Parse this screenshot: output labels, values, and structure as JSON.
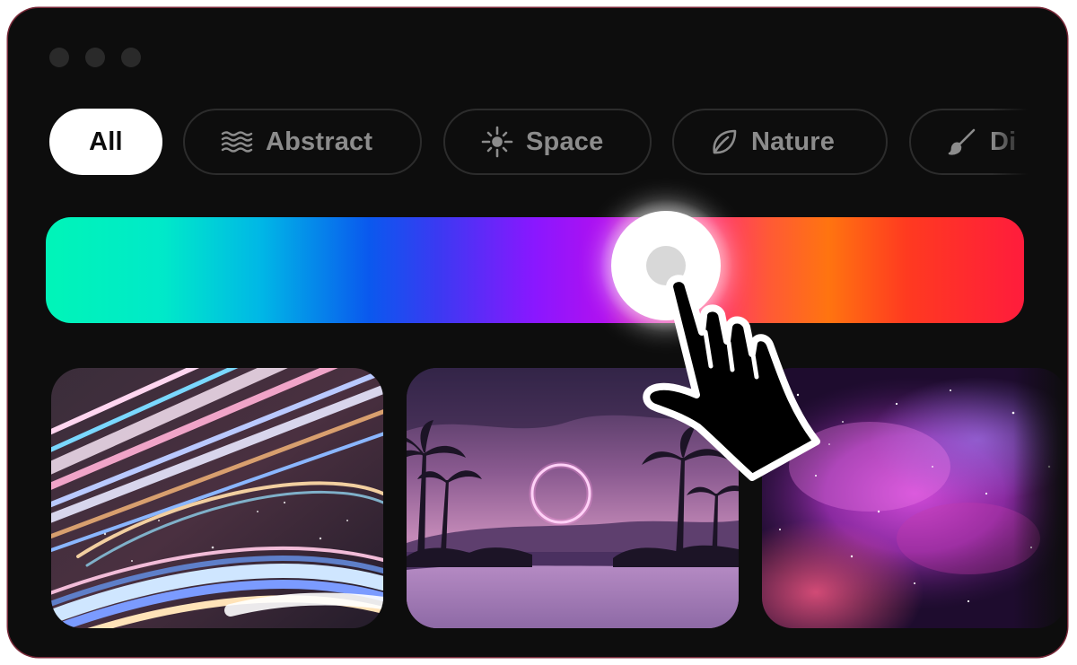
{
  "window_controls": [
    "dot",
    "dot",
    "dot"
  ],
  "tabs": [
    {
      "label": "All",
      "icon": "",
      "active": true
    },
    {
      "label": "Abstract",
      "icon": "waves-icon",
      "active": false
    },
    {
      "label": "Space",
      "icon": "sparkle-icon",
      "active": false
    },
    {
      "label": "Nature",
      "icon": "leaf-icon",
      "active": false
    },
    {
      "label": "Di",
      "icon": "brush-icon",
      "active": false
    }
  ],
  "color_slider": {
    "value_fraction": 0.636,
    "gradient_colors": [
      "#00f5b8",
      "#0a59ee",
      "#8a17ff",
      "#ff2f7a",
      "#ff7410",
      "#ff1c3c"
    ]
  },
  "gallery": [
    {
      "name": "abstract-light-streaks",
      "theme": "abstract"
    },
    {
      "name": "palm-beach-neon-ring",
      "theme": "nature"
    },
    {
      "name": "purple-nebula",
      "theme": "space"
    }
  ],
  "cursor": {
    "icon": "pointing-hand-icon"
  },
  "colors": {
    "background": "#0d0d0d",
    "tab_border": "#2c2c2c",
    "tab_text": "#8c8c8c",
    "active_tab": "#ffffff"
  }
}
